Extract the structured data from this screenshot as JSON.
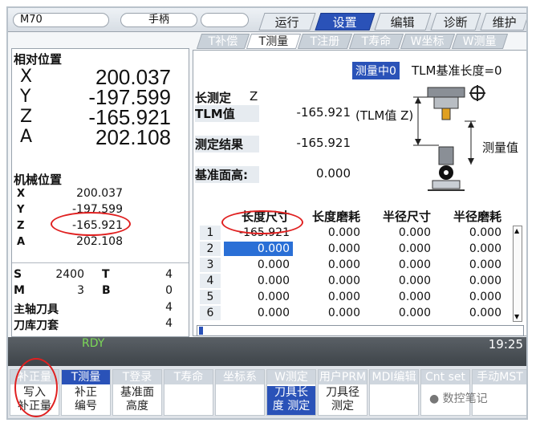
{
  "header": {
    "machine": "M70",
    "mode": "手柄",
    "tabs": [
      {
        "label": "运行",
        "active": false
      },
      {
        "label": "设置",
        "active": true
      },
      {
        "label": "编辑",
        "active": false
      },
      {
        "label": "诊断",
        "active": false
      },
      {
        "label": "维护",
        "active": false
      }
    ]
  },
  "subtabs": [
    {
      "label": "T补偿",
      "active": false
    },
    {
      "label": "T测量",
      "active": true
    },
    {
      "label": "T注册",
      "active": false
    },
    {
      "label": "T寿命",
      "active": false
    },
    {
      "label": "W坐标",
      "active": false
    },
    {
      "label": "W测量",
      "active": false
    }
  ],
  "left": {
    "relative_title": "相对位置",
    "relative": [
      {
        "axis": "X",
        "value": "200.037"
      },
      {
        "axis": "Y",
        "value": "-197.599"
      },
      {
        "axis": "Z",
        "value": "-165.921"
      },
      {
        "axis": "A",
        "value": "202.108"
      }
    ],
    "machine_title": "机械位置",
    "machine": [
      {
        "axis": "X",
        "value": "200.037"
      },
      {
        "axis": "Y",
        "value": "-197.599"
      },
      {
        "axis": "Z",
        "value": "-165.921"
      },
      {
        "axis": "A",
        "value": "202.108"
      }
    ],
    "s_label": "S",
    "s_value": "2400",
    "t_label": "T",
    "t_value": "4",
    "m_label": "M",
    "m_value": "3",
    "b_label": "B",
    "b_value": "0",
    "spindle_tool_label": "主轴刀具",
    "spindle_tool_value": "4",
    "magazine_tool_label": "刀库刀套",
    "magazine_tool_value": "4"
  },
  "right": {
    "measuring_badge": "测量中0",
    "tlm_base": "TLM基准长度=0",
    "length_measure_label": "长测定",
    "length_measure_axis": "Z",
    "tlm_label": "TLM值",
    "tlm_value": "-165.921",
    "tlm_note": "(TLM值 Z)",
    "result_label": "测定结果",
    "result_value": "-165.921",
    "base_height_label": "基准面高:",
    "base_height_value": "0.000",
    "diagram_label": "测量值",
    "columns": [
      "长度尺寸",
      "长度磨耗",
      "半径尺寸",
      "半径磨耗"
    ],
    "rows": [
      {
        "num": "1",
        "cells": [
          "-165.921",
          "0.000",
          "0.000",
          "0.000"
        ]
      },
      {
        "num": "2",
        "cells": [
          "0.000",
          "0.000",
          "0.000",
          "0.000"
        ]
      },
      {
        "num": "3",
        "cells": [
          "0.000",
          "0.000",
          "0.000",
          "0.000"
        ]
      },
      {
        "num": "4",
        "cells": [
          "0.000",
          "0.000",
          "0.000",
          "0.000"
        ]
      },
      {
        "num": "5",
        "cells": [
          "0.000",
          "0.000",
          "0.000",
          "0.000"
        ]
      },
      {
        "num": "6",
        "cells": [
          "0.000",
          "0.000",
          "0.000",
          "0.000"
        ]
      }
    ]
  },
  "status": {
    "rdy": "RDY",
    "time": "19:25"
  },
  "softkeys": [
    {
      "top": "补正量",
      "top_on": false,
      "lines": [
        "写入",
        "补正量"
      ]
    },
    {
      "top": "T测量",
      "top_on": true,
      "lines": [
        "补正",
        "编号"
      ]
    },
    {
      "top": "T登录",
      "top_on": false,
      "lines": [
        "基准面",
        "高度"
      ]
    },
    {
      "top": "T寿命",
      "top_on": false,
      "lines": []
    },
    {
      "top": "坐标系",
      "top_on": false,
      "lines": []
    },
    {
      "top": "W测定",
      "top_on": false,
      "lines": [
        "刀具长",
        "度 测定"
      ],
      "hl": true
    },
    {
      "top": "用户PRM",
      "top_on": false,
      "lines": [
        "刀具径",
        "测定"
      ]
    },
    {
      "top": "MDI编辑",
      "top_on": false,
      "lines": []
    },
    {
      "top": "Cnt set",
      "top_on": false,
      "lines": []
    },
    {
      "top": "手动MST",
      "top_on": false,
      "lines": []
    }
  ],
  "watermark": "数控笔记"
}
